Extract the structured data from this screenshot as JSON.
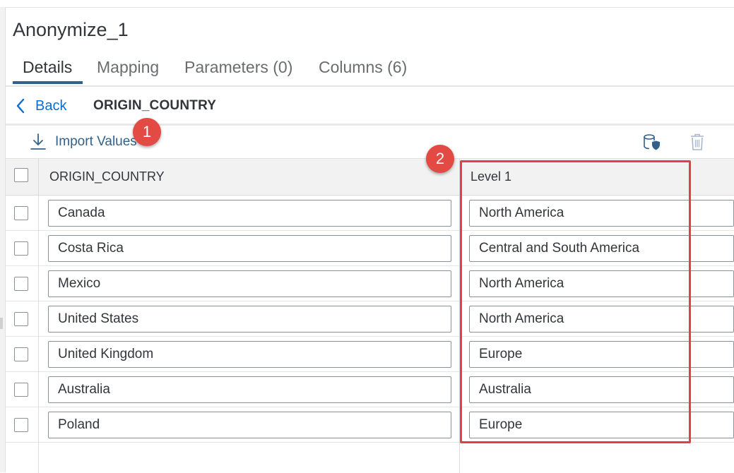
{
  "page": {
    "title": "Anonymize_1"
  },
  "tabs": [
    {
      "label": "Details",
      "active": true
    },
    {
      "label": "Mapping",
      "active": false
    },
    {
      "label": "Parameters (0)",
      "active": false
    },
    {
      "label": "Columns (6)",
      "active": false
    }
  ],
  "nav": {
    "back_label": "Back",
    "field_name": "ORIGIN_COUNTRY"
  },
  "toolbar": {
    "import_label": "Import Values",
    "icons": [
      "import-icon",
      "database-shield-icon",
      "trash-icon"
    ]
  },
  "annotations": {
    "badge_1": "1",
    "badge_2": "2",
    "color": "#e34a43"
  },
  "table": {
    "columns": [
      "ORIGIN_COUNTRY",
      "Level 1"
    ],
    "rows": [
      {
        "origin": "Canada",
        "level1": "North America"
      },
      {
        "origin": "Costa Rica",
        "level1": "Central and South America"
      },
      {
        "origin": "Mexico",
        "level1": "North America"
      },
      {
        "origin": "United States",
        "level1": "North America"
      },
      {
        "origin": "United Kingdom",
        "level1": "Europe"
      },
      {
        "origin": "Australia",
        "level1": "Australia"
      },
      {
        "origin": "Poland",
        "level1": "Europe"
      }
    ]
  },
  "colors": {
    "link": "#0a6ed1",
    "tab_active_underline": "#346187",
    "highlight": "#e0404a"
  }
}
